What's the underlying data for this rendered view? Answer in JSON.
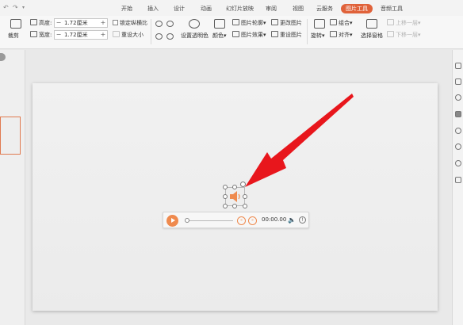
{
  "quick_access": [
    "↶",
    "↷",
    "▾"
  ],
  "menu_tabs": [
    "开始",
    "插入",
    "设计",
    "动画",
    "幻灯片放映",
    "审阅",
    "视图",
    "云服务",
    "图片工具",
    "音频工具"
  ],
  "active_tab": "图片工具",
  "ribbon": {
    "crop_label": "裁剪",
    "height_label": "高度:",
    "height_value": "1.72厘米",
    "width_label": "宽度:",
    "width_value": "1.72厘米",
    "lock_ratio_label": "锁定纵横比",
    "reset_size_label": "重设大小",
    "set_transparent_label": "设置透明色",
    "color_label": "颜色",
    "picture_outline_label": "图片轮廓",
    "picture_effect_label": "图片效果",
    "change_picture_label": "更改图片",
    "reset_picture_label": "重设图片",
    "rotate_label": "旋转",
    "group_label": "组合",
    "align_label": "对齐",
    "selection_pane_label": "选择窗格",
    "bring_forward_label": "上移一层",
    "send_backward_label": "下移一层"
  },
  "player": {
    "time": "00:00.00",
    "rewind_icon": "«",
    "forward_icon": "»",
    "volume_icon": "🔈",
    "info_icon": "!"
  },
  "colors": {
    "accent": "#e0623a",
    "player_orange": "#ef8a4e",
    "arrow_red": "#e8161c"
  }
}
